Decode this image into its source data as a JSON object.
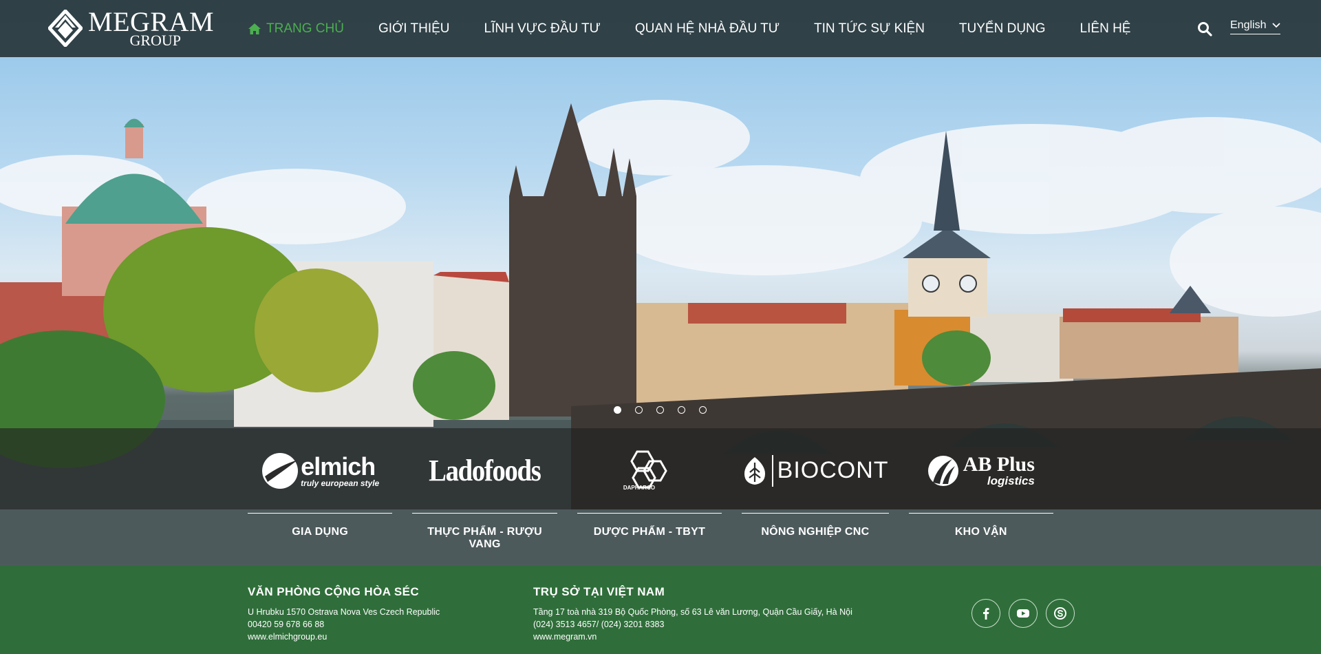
{
  "header": {
    "logo_title": "MEGRAM",
    "logo_subtitle": "GROUP",
    "nav": [
      {
        "label": "TRANG CHỦ",
        "active": true
      },
      {
        "label": "GIỚI THIỆU"
      },
      {
        "label": "LĨNH VỰC ĐẦU TƯ"
      },
      {
        "label": "QUAN HỆ NHÀ ĐẦU TƯ"
      },
      {
        "label": "TIN TỨC SỰ KIỆN"
      },
      {
        "label": "TUYỂN DỤNG"
      },
      {
        "label": "LIÊN HỆ"
      }
    ],
    "language": "English"
  },
  "slider": {
    "count": 5,
    "active_index": 0
  },
  "brands": [
    {
      "name": "elmich",
      "tagline": "truly european style",
      "label": "GIA DỤNG"
    },
    {
      "name": "Ladofoods",
      "label": "THỰC PHẨM - RƯỢU VANG"
    },
    {
      "name": "DAPHARCO",
      "label": "DƯỢC PHẨM - TBYT"
    },
    {
      "name": "BIOCONT",
      "label": "NÔNG NGHIỆP CNC"
    },
    {
      "name": "AB Plus",
      "tagline": "logistics",
      "label": "KHO VẬN"
    }
  ],
  "footer": {
    "office_cz": {
      "title": "VĂN PHÒNG CỘNG HÒA SÉC",
      "address": "U Hrubku 1570 Ostrava Nova Ves Czech Republic",
      "phone": "00420 59 678 66 88",
      "website": "www.elmichgroup.eu"
    },
    "office_vn": {
      "title": "TRỤ SỞ TẠI VIỆT NAM",
      "address": "Tầng 17 toà nhà 319 Bộ Quốc Phòng, số 63 Lê văn Lương, Quận Cầu Giấy, Hà Nội",
      "phone": "(024) 3513 4657/ (024) 3201 8383",
      "website": "www.megram.vn"
    },
    "social": [
      "facebook-icon",
      "youtube-icon",
      "skype-icon"
    ]
  },
  "colors": {
    "header_bg": "#28373a",
    "nav_active": "#4caf50",
    "footer_bg": "#2f6e3a"
  }
}
